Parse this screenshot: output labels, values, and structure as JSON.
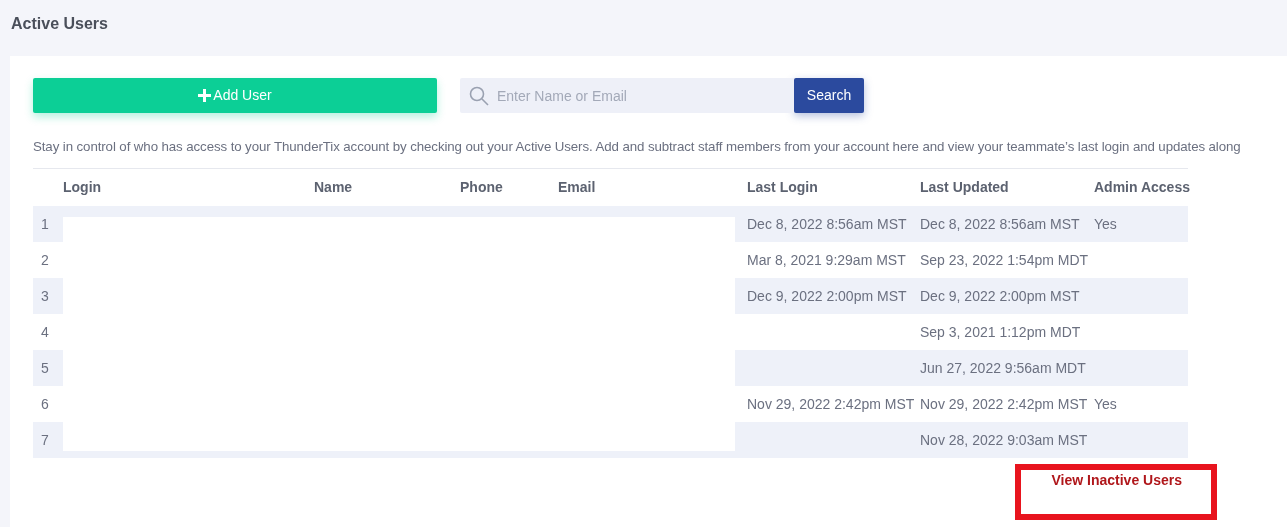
{
  "page_title": "Active Users",
  "add_button": {
    "label": "Add User"
  },
  "search": {
    "placeholder": "Enter Name or Email",
    "button": "Search"
  },
  "description": "Stay in control of who has access to your ThunderTix account by checking out your Active Users. Add and subtract staff members from your account here and view your teammate’s last login and updates along",
  "table": {
    "columns": [
      "Login",
      "Name",
      "Phone",
      "Email",
      "Last Login",
      "Last Updated",
      "Admin Access"
    ],
    "rows": [
      {
        "index": "1",
        "last_login": "Dec 8, 2022 8:56am MST",
        "last_updated": "Dec 8, 2022 8:56am MST",
        "admin_access": "Yes"
      },
      {
        "index": "2",
        "last_login": "Mar 8, 2021 9:29am MST",
        "last_updated": "Sep 23, 2022 1:54pm MDT"
      },
      {
        "index": "3",
        "last_login": "Dec 9, 2022 2:00pm MST",
        "last_updated": "Dec 9, 2022 2:00pm MST"
      },
      {
        "index": "4",
        "last_updated": "Sep 3, 2021 1:12pm MDT"
      },
      {
        "index": "5",
        "last_updated": "Jun 27, 2022 9:56am MDT"
      },
      {
        "index": "6",
        "last_login": "Nov 29, 2022 2:42pm MST",
        "last_updated": "Nov 29, 2022 2:42pm MST",
        "admin_access": "Yes"
      },
      {
        "index": "7",
        "last_updated": "Nov 28, 2022 9:03am MST"
      }
    ]
  },
  "inactive_link": "View Inactive Users"
}
